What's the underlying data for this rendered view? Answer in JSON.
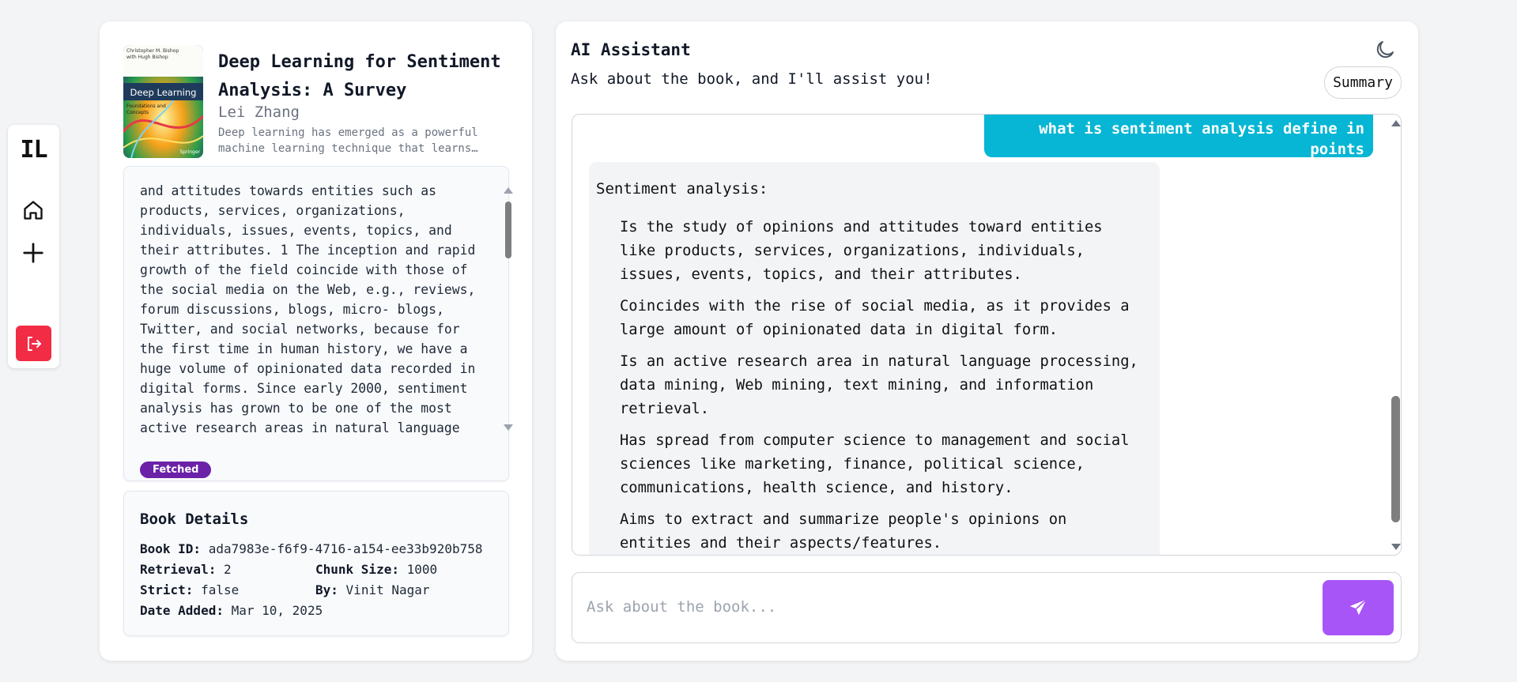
{
  "rail": {
    "logo": "IL",
    "icons": [
      "home-icon",
      "plus-icon",
      "logout-icon"
    ]
  },
  "book": {
    "title": "Deep Learning for Sentiment Analysis: A Survey",
    "author": "Lei Zhang",
    "description": "Deep learning has emerged as a powerful machine learning technique that learns multiple layers of representations or features of the data and produces state-of-the-art prediction results.",
    "cover": {
      "title": "Deep Learning",
      "authors": "Christopher M. Bishop with Hugh Bishop",
      "subtitle": "Foundations and Concepts",
      "publisher": "Springer"
    },
    "content": "and attitudes towards entities such as products, services, organizations, individuals, issues, events, topics, and their attributes. 1 The inception and rapid growth of the field coincide with those of the social media on the Web, e.g., reviews, forum discussions, blogs, micro- blogs, Twitter, and social networks, because for the first time in human history, we have a huge volume of opinionated data recorded in digital forms. Since early 2000, sentiment analysis has grown to be one of the most active research areas in natural language",
    "status": "Fetched",
    "colors": {
      "status": "#6b21a8"
    }
  },
  "details": {
    "heading": "Book Details",
    "book_id_label": "Book ID:",
    "book_id": "ada7983e-f6f9-4716-a154-ee33b920b758",
    "retrieval_label": "Retrieval:",
    "retrieval": "2",
    "chunk_label": "Chunk Size:",
    "chunk": "1000",
    "strict_label": "Strict:",
    "strict": "false",
    "by_label": "By:",
    "by": "Vinit Nagar",
    "date_label": "Date Added:",
    "date": "Mar 10, 2025"
  },
  "assistant": {
    "title": "AI Assistant",
    "subtitle": "Ask about the book, and I'll assist you!",
    "summary_label": "Summary",
    "theme_icon": "moon-icon",
    "colors": {
      "user_bubble": "#06b6d4",
      "send": "#a855f7",
      "logout": "#f22c45"
    },
    "messages": {
      "user": "what is sentiment analysis define in points",
      "bot_heading": "Sentiment analysis:",
      "bot_points": [
        "Is the study of opinions and attitudes toward entities like products, services, organizations, individuals, issues, events, topics, and their attributes.",
        "Coincides with the rise of social media, as it provides a large amount of opinionated data in digital form.",
        "Is an active research area in natural language processing, data mining, Web mining, text mining, and information retrieval.",
        "Has spread from computer science to management and social sciences like marketing, finance, political science, communications, health science, and history.",
        "Aims to extract and summarize people's opinions on entities and their aspects/features."
      ]
    },
    "input_placeholder": "Ask about the book..."
  }
}
